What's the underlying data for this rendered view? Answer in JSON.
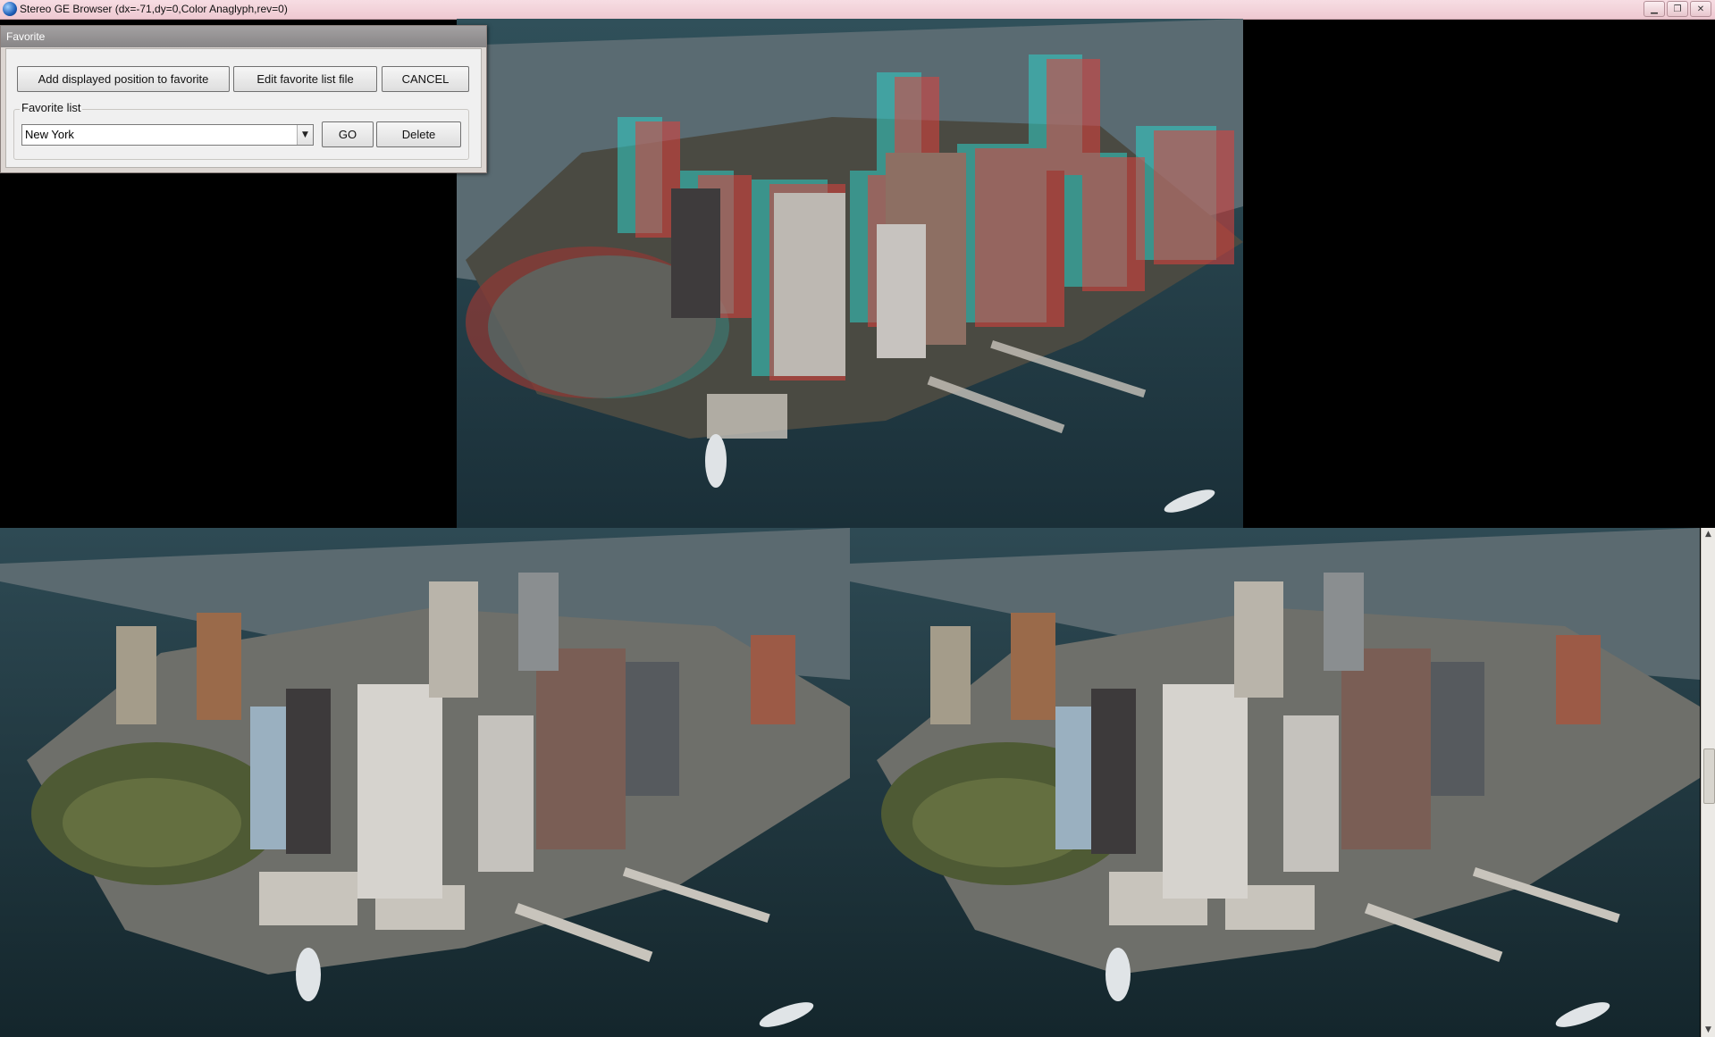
{
  "window": {
    "title": "Stereo GE Browser (dx=-71,dy=0,Color Anaglyph,rev=0)",
    "minimize_glyph": "▁",
    "restore_glyph": "❐",
    "close_glyph": "✕",
    "app_icon": "globe-icon"
  },
  "dialog": {
    "title": "Favorite",
    "add_button": "Add displayed position to favorite",
    "edit_button": "Edit favorite list file",
    "cancel_button": "CANCEL",
    "group_label": "Favorite list",
    "selected_favorite": "New York",
    "dropdown_glyph": "▼",
    "go_button": "GO",
    "delete_button": "Delete"
  },
  "scrollbar": {
    "up_glyph": "▲",
    "down_glyph": "▼"
  },
  "colors": {
    "title_bar": "#f0d0d7",
    "water": "#1d3b46",
    "anaglyph_red": "#e0403c",
    "anaglyph_cyan": "#2fd0c8",
    "park": "#5a6a3a",
    "building": "#8f8d88"
  }
}
